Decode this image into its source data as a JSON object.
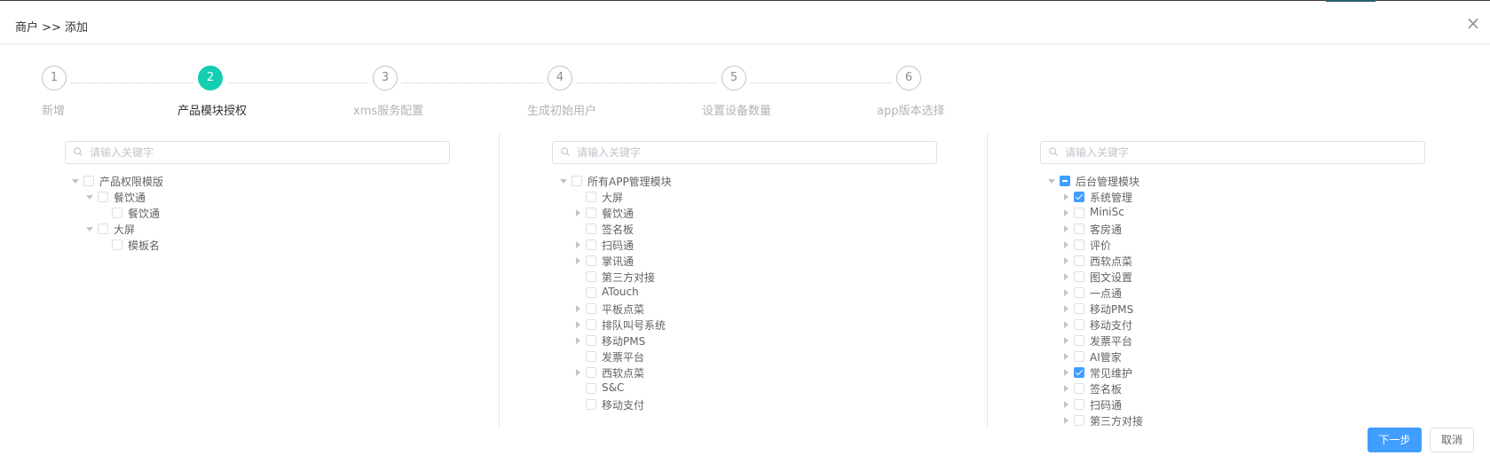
{
  "dialog": {
    "title": "商户 >> 添加",
    "close_glyph": "×"
  },
  "steps": [
    {
      "number": "1",
      "label": "新增",
      "active": false
    },
    {
      "number": "2",
      "label": "产品模块授权",
      "active": true
    },
    {
      "number": "3",
      "label": "xms服务配置",
      "active": false
    },
    {
      "number": "4",
      "label": "生成初始用户",
      "active": false
    },
    {
      "number": "5",
      "label": "设置设备数量",
      "active": false
    },
    {
      "number": "6",
      "label": "app版本选择",
      "active": false
    }
  ],
  "panels": [
    {
      "search_placeholder": "请输入关键字",
      "tree": [
        {
          "label": "产品权限模版",
          "level": 0,
          "expanded": true,
          "has_children": true,
          "state": "unchecked"
        },
        {
          "label": "餐饮通",
          "level": 1,
          "expanded": true,
          "has_children": true,
          "state": "unchecked"
        },
        {
          "label": "餐饮通",
          "level": 2,
          "expanded": false,
          "has_children": false,
          "state": "unchecked"
        },
        {
          "label": "大屏",
          "level": 1,
          "expanded": true,
          "has_children": true,
          "state": "unchecked"
        },
        {
          "label": "模板名",
          "level": 2,
          "expanded": false,
          "has_children": false,
          "state": "unchecked"
        }
      ]
    },
    {
      "search_placeholder": "请输入关键字",
      "tree": [
        {
          "label": "所有APP管理模块",
          "level": 0,
          "expanded": true,
          "has_children": true,
          "state": "unchecked"
        },
        {
          "label": "大屏",
          "level": 1,
          "expanded": false,
          "has_children": false,
          "state": "unchecked"
        },
        {
          "label": "餐饮通",
          "level": 1,
          "expanded": false,
          "has_children": true,
          "state": "unchecked"
        },
        {
          "label": "签名板",
          "level": 1,
          "expanded": false,
          "has_children": false,
          "state": "unchecked"
        },
        {
          "label": "扫码通",
          "level": 1,
          "expanded": false,
          "has_children": true,
          "state": "unchecked"
        },
        {
          "label": "掌讯通",
          "level": 1,
          "expanded": false,
          "has_children": true,
          "state": "unchecked"
        },
        {
          "label": "第三方对接",
          "level": 1,
          "expanded": false,
          "has_children": false,
          "state": "unchecked"
        },
        {
          "label": "ATouch",
          "level": 1,
          "expanded": false,
          "has_children": false,
          "state": "unchecked"
        },
        {
          "label": "平板点菜",
          "level": 1,
          "expanded": false,
          "has_children": true,
          "state": "unchecked"
        },
        {
          "label": "排队叫号系统",
          "level": 1,
          "expanded": false,
          "has_children": true,
          "state": "unchecked"
        },
        {
          "label": "移动PMS",
          "level": 1,
          "expanded": false,
          "has_children": true,
          "state": "unchecked"
        },
        {
          "label": "发票平台",
          "level": 1,
          "expanded": false,
          "has_children": false,
          "state": "unchecked"
        },
        {
          "label": "西软点菜",
          "level": 1,
          "expanded": false,
          "has_children": true,
          "state": "unchecked"
        },
        {
          "label": "S&C",
          "level": 1,
          "expanded": false,
          "has_children": false,
          "state": "unchecked"
        },
        {
          "label": "移动支付",
          "level": 1,
          "expanded": false,
          "has_children": false,
          "state": "unchecked"
        }
      ]
    },
    {
      "search_placeholder": "请输入关键字",
      "tree": [
        {
          "label": "后台管理模块",
          "level": 0,
          "expanded": true,
          "has_children": true,
          "state": "indeterminate"
        },
        {
          "label": "系统管理",
          "level": 1,
          "expanded": false,
          "has_children": true,
          "state": "checked"
        },
        {
          "label": "MiniSc",
          "level": 1,
          "expanded": false,
          "has_children": true,
          "state": "unchecked"
        },
        {
          "label": "客房通",
          "level": 1,
          "expanded": false,
          "has_children": true,
          "state": "unchecked"
        },
        {
          "label": "评价",
          "level": 1,
          "expanded": false,
          "has_children": true,
          "state": "unchecked"
        },
        {
          "label": "西软点菜",
          "level": 1,
          "expanded": false,
          "has_children": true,
          "state": "unchecked"
        },
        {
          "label": "图文设置",
          "level": 1,
          "expanded": false,
          "has_children": true,
          "state": "unchecked"
        },
        {
          "label": "一点通",
          "level": 1,
          "expanded": false,
          "has_children": true,
          "state": "unchecked"
        },
        {
          "label": "移动PMS",
          "level": 1,
          "expanded": false,
          "has_children": true,
          "state": "unchecked"
        },
        {
          "label": "移动支付",
          "level": 1,
          "expanded": false,
          "has_children": true,
          "state": "unchecked"
        },
        {
          "label": "发票平台",
          "level": 1,
          "expanded": false,
          "has_children": true,
          "state": "unchecked"
        },
        {
          "label": "AI管家",
          "level": 1,
          "expanded": false,
          "has_children": true,
          "state": "unchecked"
        },
        {
          "label": "常见维护",
          "level": 1,
          "expanded": false,
          "has_children": true,
          "state": "checked"
        },
        {
          "label": "签名板",
          "level": 1,
          "expanded": false,
          "has_children": true,
          "state": "unchecked"
        },
        {
          "label": "扫码通",
          "level": 1,
          "expanded": false,
          "has_children": true,
          "state": "unchecked"
        },
        {
          "label": "第三方对接",
          "level": 1,
          "expanded": false,
          "has_children": true,
          "state": "unchecked"
        }
      ]
    }
  ],
  "footer": {
    "next_label": "下一步",
    "cancel_label": "取消"
  },
  "colors": {
    "active_step": "#13ceb1",
    "primary": "#409eff",
    "checkbox_checked": "#409eff"
  }
}
